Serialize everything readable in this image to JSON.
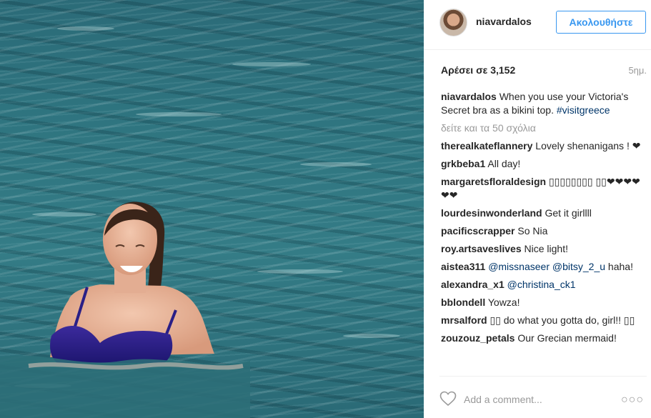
{
  "post": {
    "username": "niavardalos",
    "follow_label": "Ακολουθήστε",
    "likes": "Αρέσει σε 3,152",
    "time": "5ημ."
  },
  "caption": {
    "username": "niavardalos",
    "text": " When you use your Victoria's Secret bra as a bikini top. ",
    "hashtag": "#visitgreece"
  },
  "view_all": "δείτε και τα 50 σχόλια",
  "comments": [
    {
      "user": "therealkateflannery",
      "text": " Lovely shenanigans ! ❤"
    },
    {
      "user": "grkbeba1",
      "text": " All day!"
    },
    {
      "user": "margaretsfloraldesign",
      "text": " ▯▯▯▯▯▯▯▯ ▯▯❤❤❤❤❤❤"
    },
    {
      "user": "lourdesinwonderland",
      "text": " Get it girllll"
    },
    {
      "user": "pacificscrapper",
      "text": " So Nia"
    },
    {
      "user": "roy.artsaveslives",
      "text": " Nice light!"
    },
    {
      "user": "aistea311",
      "m1": "@missnaseer",
      "m2": "@bitsy_2_u",
      "text": " haha!"
    },
    {
      "user": "alexandra_x1",
      "m1": "@christina_ck1"
    },
    {
      "user": "bblondell",
      "text": " Yowza!"
    },
    {
      "user": "mrsalford",
      "text": " ▯▯ do what you gotta do, girl!! ▯▯"
    },
    {
      "user": "zouzouz_petals",
      "text": " Our Grecian mermaid!"
    }
  ],
  "footer": {
    "add_comment_placeholder": "Add a comment...",
    "more_label": "○○○"
  },
  "icons": {
    "heart": "heart-icon",
    "more": "more-options-icon"
  },
  "colors": {
    "accent": "#3897f0",
    "mention": "#003569",
    "muted": "#999999"
  }
}
